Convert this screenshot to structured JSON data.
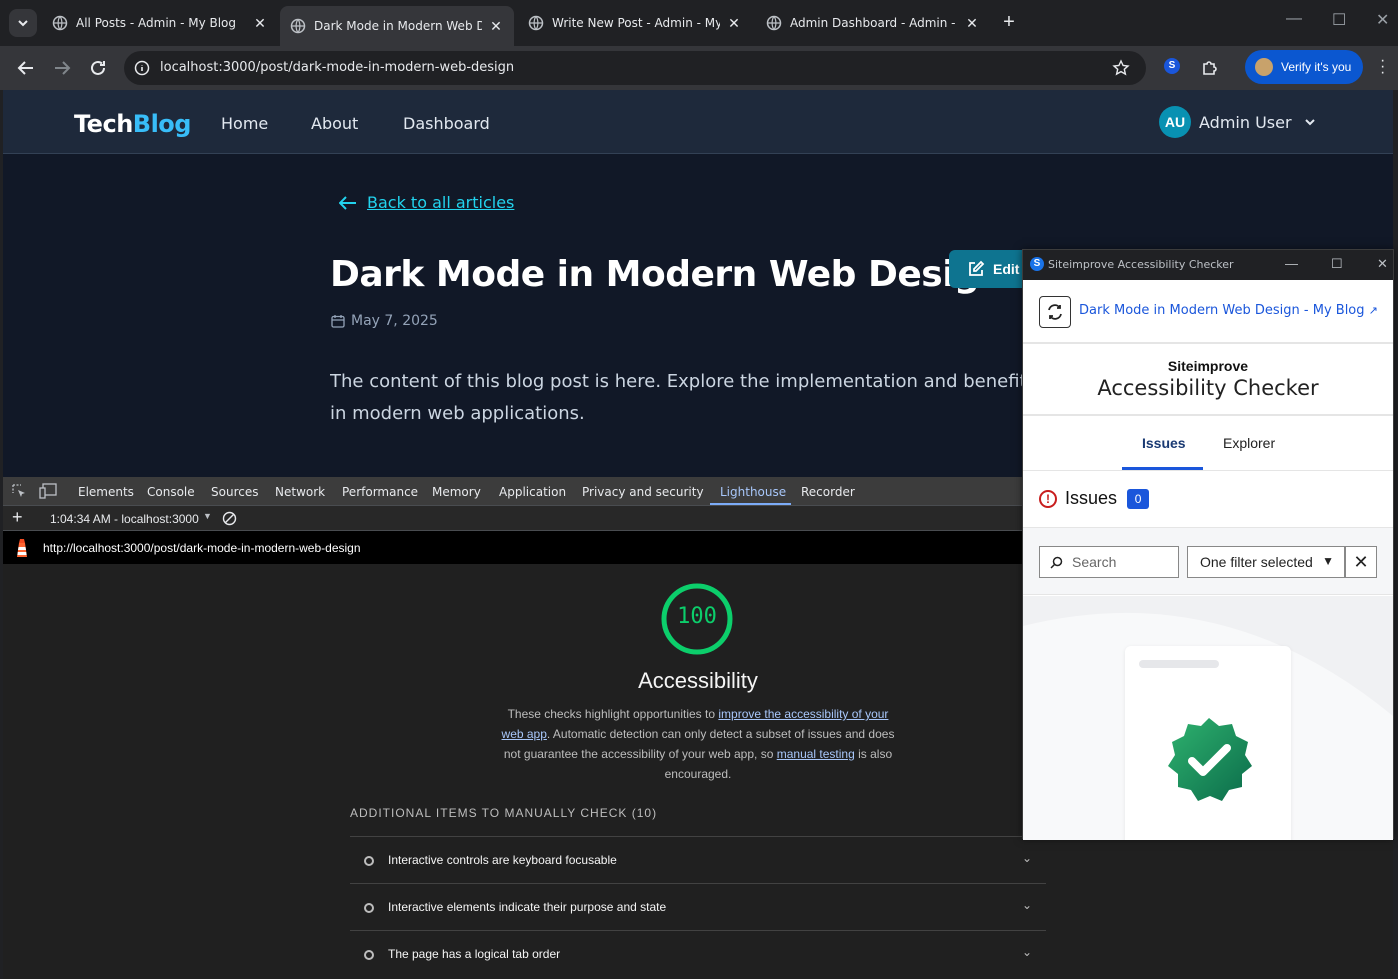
{
  "browser": {
    "tabs": [
      {
        "title": "All Posts - Admin - My Blog"
      },
      {
        "title": "Dark Mode in Modern Web Des"
      },
      {
        "title": "Write New Post - Admin - My B"
      },
      {
        "title": "Admin Dashboard - Admin - My"
      }
    ],
    "url": "localhost:3000/post/dark-mode-in-modern-web-design",
    "profile_label": "Verify it's you",
    "extension_badge": "S"
  },
  "site": {
    "logo_part1": "Tech",
    "logo_part2": "Blog",
    "nav": [
      "Home",
      "About",
      "Dashboard"
    ],
    "user_initials": "AU",
    "user_name": "Admin User"
  },
  "post": {
    "back_label": "Back to all articles",
    "title": "Dark Mode in Modern Web Design",
    "edit_label": "Edit",
    "date": "May 7, 2025",
    "body_line1": "The content of this blog post is here. Explore the implementation and benefits of dark mode",
    "body_line2": "in modern web applications."
  },
  "devtools": {
    "tabs": [
      "Elements",
      "Console",
      "Sources",
      "Network",
      "Performance",
      "Memory",
      "Application",
      "Privacy and security",
      "Lighthouse",
      "Recorder"
    ],
    "active_tab": "Lighthouse",
    "report_select": "1:04:34 AM - localhost:3000",
    "report_url": "http://localhost:3000/post/dark-mode-in-modern-web-design"
  },
  "lighthouse": {
    "score": "100",
    "score_color": "#0cce6b",
    "category": "Accessibility",
    "desc_1": "These checks highlight opportunities to ",
    "desc_link1": "improve the accessibility of your web app",
    "desc_2": ". Automatic detection can only detect a subset of issues and does not guarantee the accessibility of your web app, so ",
    "desc_link2": "manual testing",
    "desc_3": " is also encouraged.",
    "section": "ADDITIONAL ITEMS TO MANUALLY CHECK (10)",
    "audits": [
      "Interactive controls are keyboard focusable",
      "Interactive elements indicate their purpose and state",
      "The page has a logical tab order"
    ]
  },
  "siteimprove": {
    "window_title": "Siteimprove Accessibility Checker",
    "page_link": "Dark Mode in Modern Web Design - My Blog",
    "brand1": "Siteimprove",
    "brand2": "Accessibility Checker",
    "tabs": [
      "Issues",
      "Explorer"
    ],
    "issues_label": "Issues",
    "issues_count": "0",
    "search_placeholder": "Search",
    "filter_label": "One filter selected"
  }
}
